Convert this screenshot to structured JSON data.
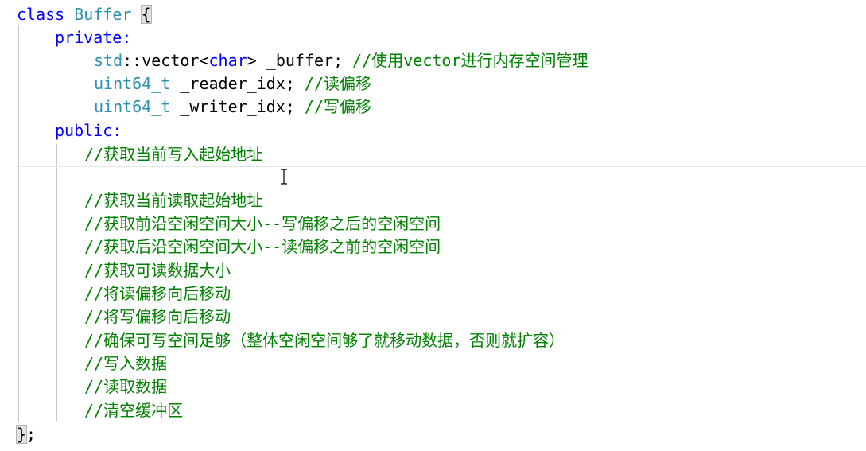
{
  "code": {
    "class_keyword": "class",
    "class_name": "Buffer",
    "open_brace": "{",
    "private_label": "private:",
    "member1": {
      "ns": "std",
      "sep": "::",
      "type": "vector",
      "lt": "<",
      "targ": "char",
      "gt": ">",
      "name": " _buffer;",
      "comment": "//使用vector进行内存空间管理"
    },
    "member2": {
      "type": "uint64_t",
      "name": " _reader_idx;",
      "comment": "//读偏移"
    },
    "member3": {
      "type": "uint64_t",
      "name": " _writer_idx;",
      "comment": "//写偏移"
    },
    "public_label": "public:",
    "comments": [
      "//获取当前写入起始地址",
      "",
      "//获取当前读取起始地址",
      "//获取前沿空闲空间大小--写偏移之后的空闲空间",
      "//获取后沿空闲空间大小--读偏移之前的空闲空间",
      "//获取可读数据大小",
      "//将读偏移向后移动",
      "//将写偏移向后移动",
      "//确保可写空间足够（整体空闲空间够了就移动数据，否则就扩容）",
      "//写入数据",
      "//读取数据",
      "//清空缓冲区"
    ],
    "close_brace": "}",
    "close_semicolon": ";"
  },
  "colors": {
    "keyword": "#0000ff",
    "type": "#2b91af",
    "comment": "#008000",
    "text": "#000000"
  },
  "cursor_icon": "text-cursor-icon"
}
